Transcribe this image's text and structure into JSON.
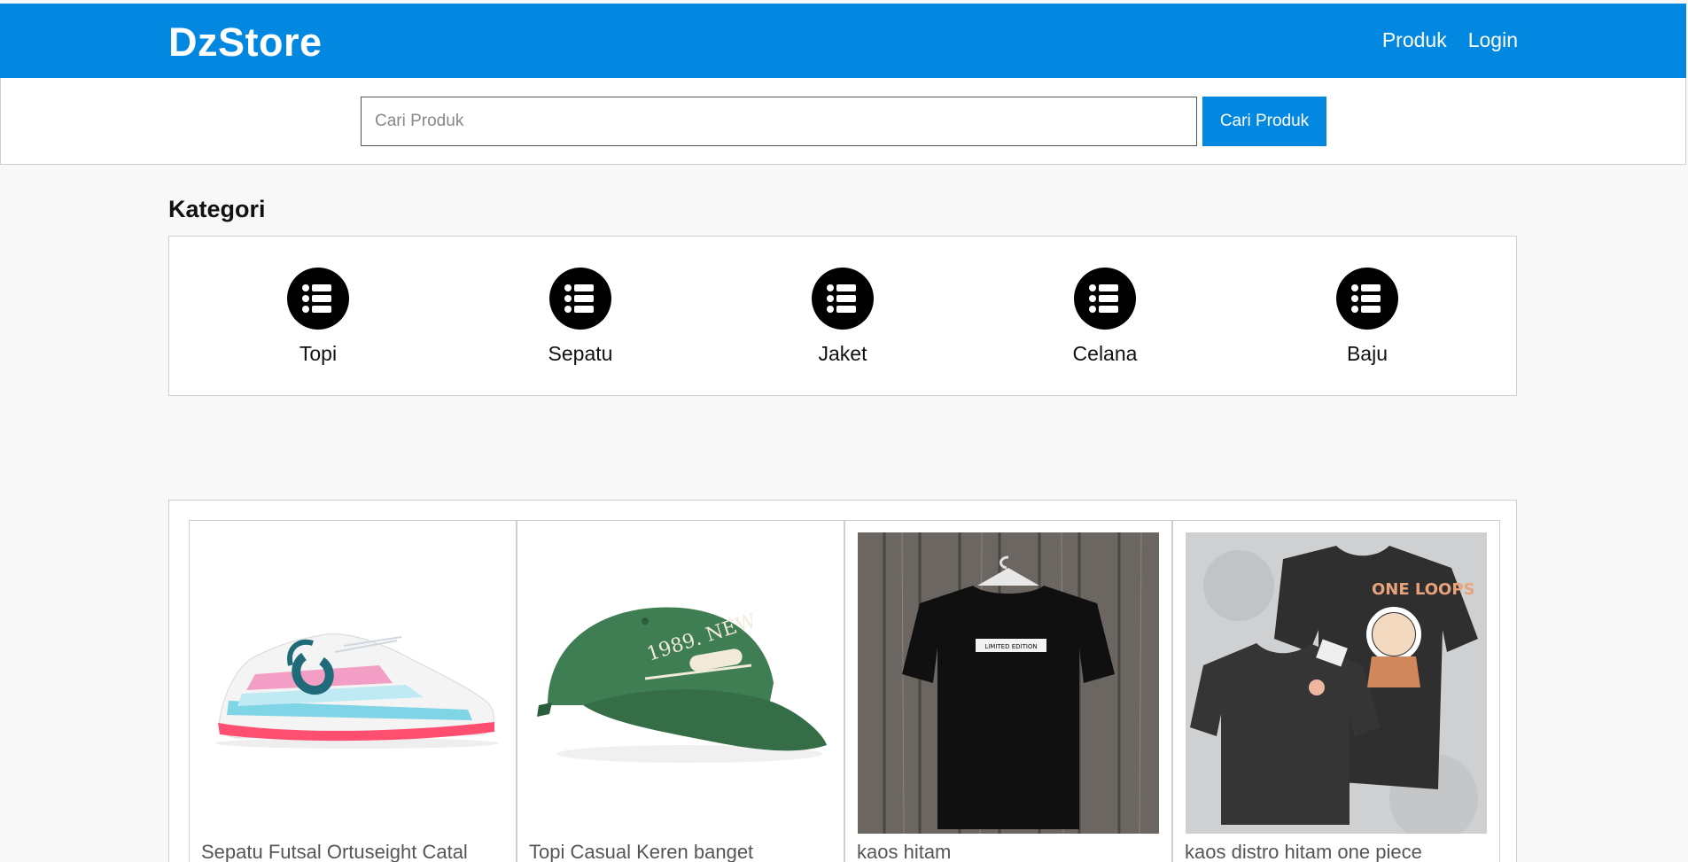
{
  "header": {
    "brand": "DzStore",
    "nav": [
      {
        "label": "Produk"
      },
      {
        "label": "Login"
      }
    ]
  },
  "search": {
    "placeholder": "Cari Produk",
    "value": "",
    "button_label": "Cari Produk"
  },
  "categories": {
    "title": "Kategori",
    "icon": "list-icon",
    "items": [
      {
        "label": "Topi"
      },
      {
        "label": "Sepatu"
      },
      {
        "label": "Jaket"
      },
      {
        "label": "Celana"
      },
      {
        "label": "Baju"
      }
    ]
  },
  "products": [
    {
      "name": "Sepatu Futsal Ortuseight Catal",
      "image": "sneaker-image"
    },
    {
      "name": "Topi Casual Keren banget",
      "image": "cap-image"
    },
    {
      "name": "kaos hitam",
      "image": "black-tshirt-image",
      "print_text": "LIMITED EDITION"
    },
    {
      "name": "kaos distro hitam one piece",
      "image": "one-piece-tshirt-image",
      "print_text": "ONE LOOPS"
    }
  ],
  "colors": {
    "primary": "#0288e0",
    "background": "#f8f8f8"
  }
}
